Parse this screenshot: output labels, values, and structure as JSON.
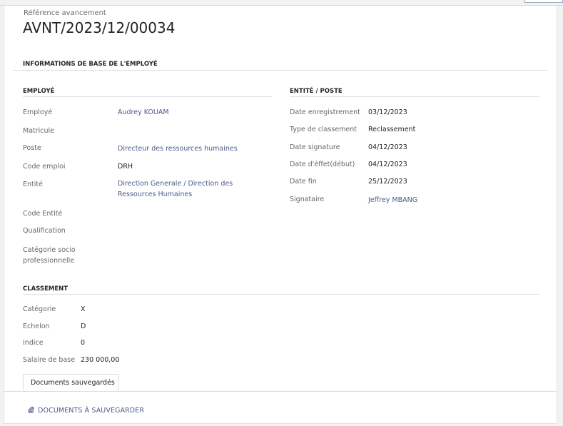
{
  "header": {
    "ref_label": "Référence avancement",
    "ref_value": "AVNT/2023/12/00034"
  },
  "base_section": {
    "title": "INFORMATIONS DE BASE DE L'EMPLOYÉ"
  },
  "employe": {
    "title": "EMPLOYÉ",
    "rows": [
      {
        "label": "Employé",
        "value": "Audrey KOUAM"
      },
      {
        "label": "Matricule",
        "value": ""
      },
      {
        "label": "Poste",
        "value": "Directeur des ressources humaines"
      },
      {
        "label": "Code emploi",
        "value": "DRH"
      },
      {
        "label": "Entité",
        "value": "Direction Generale / Direction des Ressources Humaines"
      },
      {
        "label": "Code Entité",
        "value": ""
      },
      {
        "label": "Qualification",
        "value": ""
      },
      {
        "label": "Catégorie socio professionnelle",
        "value": ""
      }
    ]
  },
  "entite_poste": {
    "title": "ENTITÉ / POSTE",
    "rows": [
      {
        "label": "Date enregistrement",
        "value": "03/12/2023"
      },
      {
        "label": "Type de classement",
        "value": "Reclassement"
      },
      {
        "label": "Date signature",
        "value": "04/12/2023"
      },
      {
        "label": "Date d'éffet(début)",
        "value": "04/12/2023"
      },
      {
        "label": "Date fin",
        "value": "25/12/2023"
      },
      {
        "label": "Signataire",
        "value": "Jeffrey MBANG"
      }
    ]
  },
  "classement": {
    "title": "CLASSEMENT",
    "rows": [
      {
        "label": "Catégorie",
        "value": "X"
      },
      {
        "label": "Echelon",
        "value": "D"
      },
      {
        "label": "Indice",
        "value": "0"
      },
      {
        "label": "Salaire de base",
        "value": "230 000,00"
      }
    ]
  },
  "tabs": [
    {
      "label": "Documents sauvegardés"
    }
  ],
  "documents_button": {
    "label": "DOCUMENTS À SAUVEGARDER",
    "icon": "paperclip-icon"
  },
  "colors": {
    "link": "#4a5a8c",
    "label": "#666666",
    "value": "#212529"
  }
}
